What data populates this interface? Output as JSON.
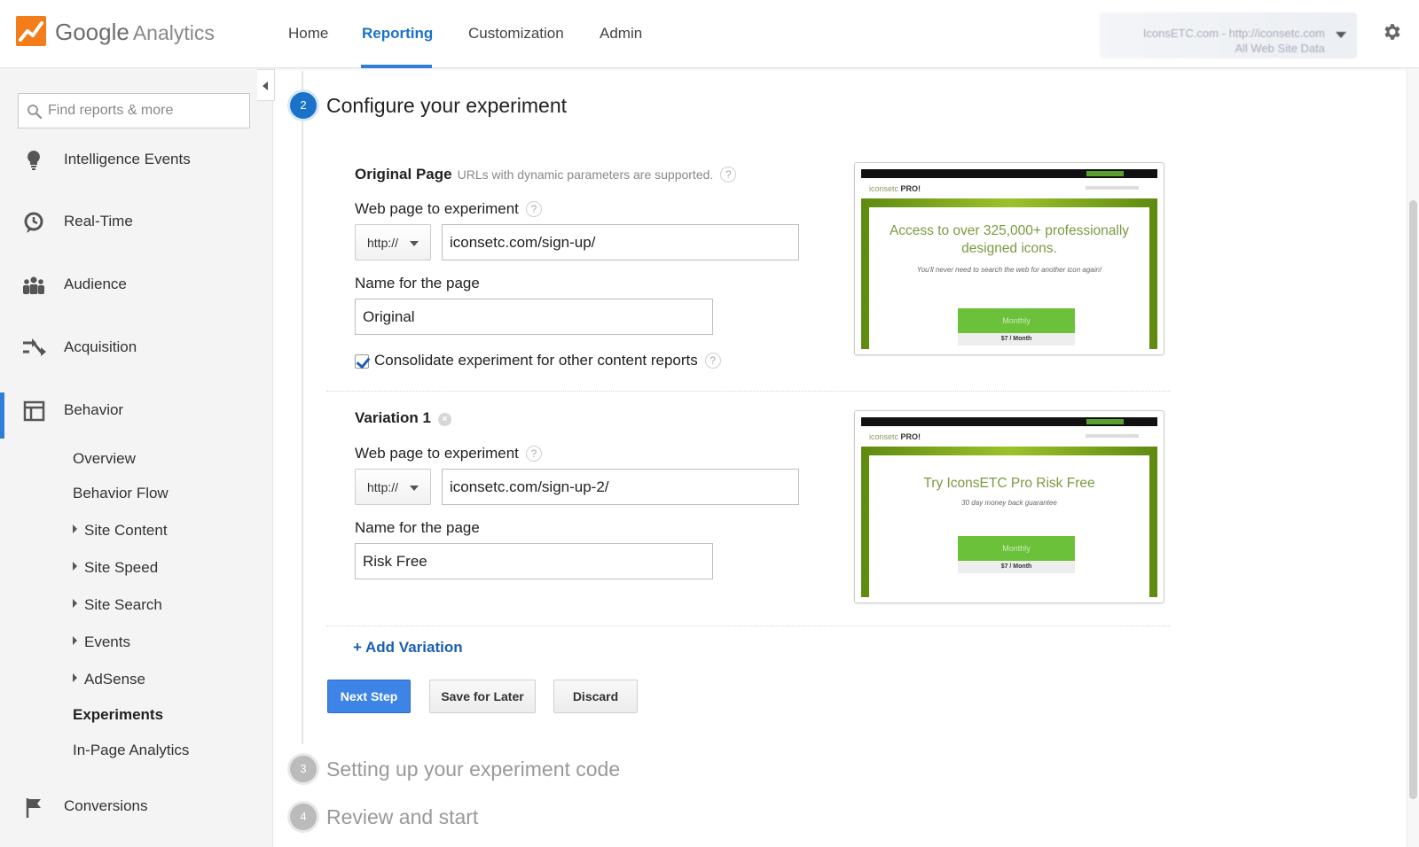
{
  "app": {
    "brand_primary": "Google",
    "brand_secondary": "Analytics",
    "accent_color": "#1a73c8"
  },
  "nav": {
    "items": [
      {
        "label": "Home",
        "active": false
      },
      {
        "label": "Reporting",
        "active": true
      },
      {
        "label": "Customization",
        "active": false
      },
      {
        "label": "Admin",
        "active": false
      }
    ]
  },
  "account": {
    "line1": "IconsETC.com - http://iconsetc.com",
    "line2": "All Web Site Data"
  },
  "sidebar": {
    "search_placeholder": "Find reports & more",
    "sections": [
      {
        "label": "Intelligence Events",
        "icon": "lightbulb-icon"
      },
      {
        "label": "Real-Time",
        "icon": "clock-icon"
      },
      {
        "label": "Audience",
        "icon": "people-icon"
      },
      {
        "label": "Acquisition",
        "icon": "acquisition-arrows-icon"
      },
      {
        "label": "Behavior",
        "icon": "behavior-layout-icon",
        "active": true
      },
      {
        "label": "Conversions",
        "icon": "flag-icon"
      }
    ],
    "behavior_children": [
      {
        "label": "Overview",
        "expandable": false
      },
      {
        "label": "Behavior Flow",
        "expandable": false
      },
      {
        "label": "Site Content",
        "expandable": true
      },
      {
        "label": "Site Speed",
        "expandable": true
      },
      {
        "label": "Site Search",
        "expandable": true
      },
      {
        "label": "Events",
        "expandable": true
      },
      {
        "label": "AdSense",
        "expandable": true
      },
      {
        "label": "Experiments",
        "expandable": false,
        "selected": true
      },
      {
        "label": "In-Page Analytics",
        "expandable": false
      }
    ]
  },
  "steps": [
    {
      "number": "2",
      "title": "Configure your experiment",
      "state": "active"
    },
    {
      "number": "3",
      "title": "Setting up your experiment code",
      "state": "inactive"
    },
    {
      "number": "4",
      "title": "Review and start",
      "state": "inactive"
    }
  ],
  "original": {
    "title": "Original Page",
    "note": "URLs with dynamic parameters are supported.",
    "url_label": "Web page to experiment",
    "protocol": "http://",
    "url_value": "iconsetc.com/sign-up/",
    "name_label": "Name for the page",
    "name_value": "Original",
    "consolidate_label": "Consolidate experiment for other content reports",
    "consolidate_checked": true,
    "preview": {
      "brand_plain": "iconsetc",
      "brand_bold": "PRO!",
      "headline_1": "Access to over 325,000+ professionally",
      "headline_2": "designed icons.",
      "subtext": "You'll never need to search the web for another icon again!",
      "button": "Monthly",
      "price": "$7 / Month"
    }
  },
  "variation": {
    "title": "Variation 1",
    "url_label": "Web page to experiment",
    "protocol": "http://",
    "url_value": "iconsetc.com/sign-up-2/",
    "name_label": "Name for the page",
    "name_value": "Risk Free",
    "preview": {
      "brand_plain": "iconsetc",
      "brand_bold": "PRO!",
      "headline": "Try IconsETC Pro Risk Free",
      "subtext": "30 day money back guarantee",
      "button": "Monthly",
      "price": "$7 / Month"
    }
  },
  "actions": {
    "add_variation": "+ Add Variation",
    "next_step": "Next Step",
    "save_for_later": "Save for Later",
    "discard": "Discard"
  },
  "help_glyph": "?"
}
